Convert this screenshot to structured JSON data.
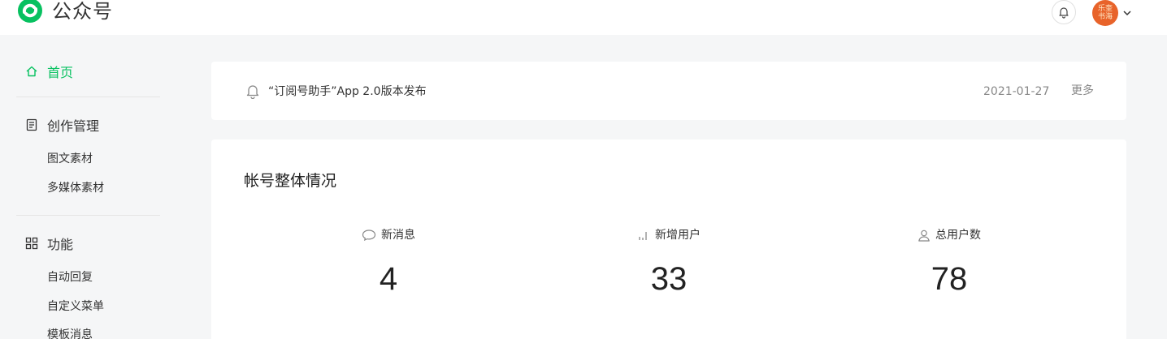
{
  "header": {
    "brand": "公众号",
    "avatar_text": "乐奎书海",
    "icons": {
      "logo": "wechat-official-logo",
      "bell": "bell-icon",
      "caret": "chevron-down-icon"
    },
    "accent_color": "#07c160"
  },
  "sidebar": {
    "home": {
      "label": "首页",
      "icon": "home-icon"
    },
    "creation": {
      "label": "创作管理",
      "icon": "document-icon",
      "items": [
        "图文素材",
        "多媒体素材"
      ]
    },
    "features": {
      "label": "功能",
      "icon": "grid-icon",
      "items": [
        "自动回复",
        "自定义菜单",
        "模板消息"
      ]
    }
  },
  "notice": {
    "title": "“订阅号助手”App 2.0版本发布",
    "date": "2021-01-27",
    "more": "更多"
  },
  "overview": {
    "heading": "帐号整体情况",
    "stats": [
      {
        "label": "新消息",
        "value": "4",
        "icon": "chat-bubble-icon"
      },
      {
        "label": "新增用户",
        "value": "33",
        "icon": "bar-chart-icon"
      },
      {
        "label": "总用户数",
        "value": "78",
        "icon": "user-icon"
      }
    ]
  }
}
